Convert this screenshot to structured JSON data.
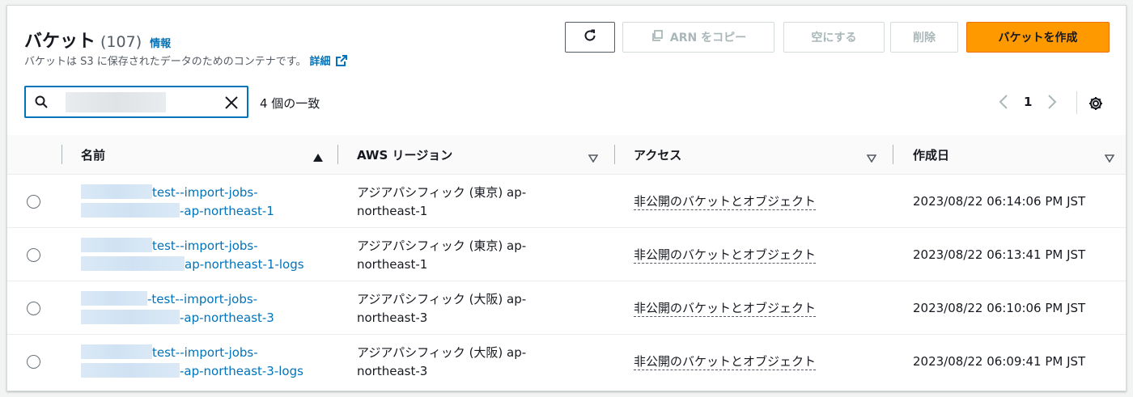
{
  "header": {
    "title": "バケット",
    "count": "(107)",
    "info_link": "情報",
    "description": "バケットは S3 に保存されたデータのためのコンテナです。",
    "details_link": "詳細"
  },
  "toolbar": {
    "copy_arn_label": "ARN をコピー",
    "empty_label": "空にする",
    "delete_label": "削除",
    "create_label": "バケットを作成"
  },
  "search": {
    "value": "",
    "matches": "4 個の一致"
  },
  "pagination": {
    "current_page": "1"
  },
  "table": {
    "columns": [
      "名前",
      "AWS リージョン",
      "アクセス",
      "作成日"
    ],
    "rows": [
      {
        "name_line1": "test--import-jobs-",
        "name_line2": "-ap-northeast-1",
        "region_line1": "アジアパシフィック (東京) ap-",
        "region_line2": "northeast-1",
        "access": "非公開のバケットとオブジェクト",
        "created": "2023/08/22 06:14:06 PM JST"
      },
      {
        "name_line1": "test--import-jobs-",
        "name_line2": "ap-northeast-1-logs",
        "region_line1": "アジアパシフィック (東京) ap-",
        "region_line2": "northeast-1",
        "access": "非公開のバケットとオブジェクト",
        "created": "2023/08/22 06:13:41 PM JST"
      },
      {
        "name_line1": "-test--import-jobs-",
        "name_line2": "-ap-northeast-3",
        "region_line1": "アジアパシフィック (大阪) ap-",
        "region_line2": "northeast-3",
        "access": "非公開のバケットとオブジェクト",
        "created": "2023/08/22 06:10:06 PM JST"
      },
      {
        "name_line1": "test--import-jobs-",
        "name_line2": "-ap-northeast-3-logs",
        "region_line1": "アジアパシフィック (大阪) ap-",
        "region_line2": "northeast-3",
        "access": "非公開のバケットとオブジェクト",
        "created": "2023/08/22 06:09:41 PM JST"
      }
    ]
  },
  "colors": {
    "link": "#0073bb",
    "primary_button": "#ff9900",
    "disabled_text": "#aab7b8"
  },
  "icons": [
    "refresh-icon",
    "copy-icon",
    "external-link-icon",
    "search-icon",
    "clear-icon",
    "chevron-left-icon",
    "chevron-right-icon",
    "settings-icon",
    "sort-ascending-icon",
    "sort-descending-icon"
  ]
}
